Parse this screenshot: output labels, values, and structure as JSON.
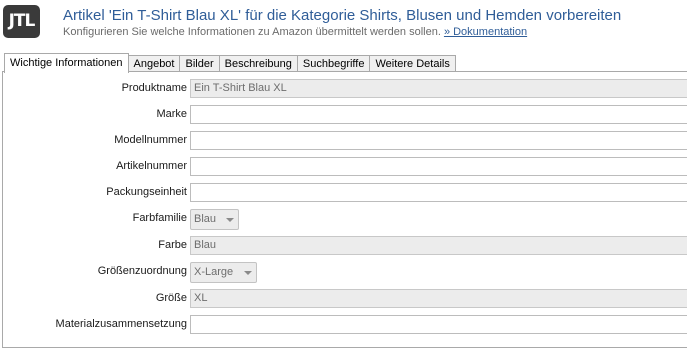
{
  "header": {
    "logo_text": "JTL",
    "title": "Artikel 'Ein T-Shirt Blau XL' für die Kategorie Shirts, Blusen und Hemden vorbereiten",
    "subtitle": "Konfigurieren Sie welche Informationen zu Amazon übermittelt werden sollen.",
    "doc_link": "» Dokumentation"
  },
  "tabs": [
    {
      "label": "Wichtige Informationen",
      "active": true
    },
    {
      "label": "Angebot"
    },
    {
      "label": "Bilder"
    },
    {
      "label": "Beschreibung"
    },
    {
      "label": "Suchbegriffe"
    },
    {
      "label": "Weitere Details"
    }
  ],
  "form": {
    "produktname": {
      "label": "Produktname",
      "value": "Ein T-Shirt Blau XL"
    },
    "marke": {
      "label": "Marke",
      "value": ""
    },
    "modellnummer": {
      "label": "Modellnummer",
      "value": ""
    },
    "artikelnummer": {
      "label": "Artikelnummer",
      "value": ""
    },
    "packungseinheit": {
      "label": "Packungseinheit",
      "value": ""
    },
    "farbfamilie": {
      "label": "Farbfamilie",
      "value": "Blau"
    },
    "farbe": {
      "label": "Farbe",
      "value": "Blau"
    },
    "groessenzuordnung": {
      "label": "Größenzuordnung",
      "value": "X-Large"
    },
    "groesse": {
      "label": "Größe",
      "value": "XL"
    },
    "materialzusammensetzung": {
      "label": "Materialzusammensetzung",
      "value": ""
    }
  }
}
